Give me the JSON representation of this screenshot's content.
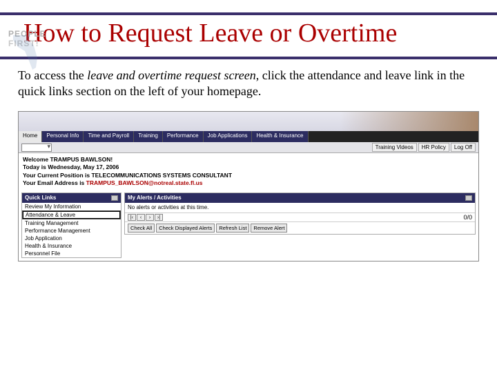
{
  "logo": {
    "line1": "PEOPLE",
    "line2": "FIRST!"
  },
  "title": "How to Request Leave or Overtime",
  "body": {
    "pre": "To access the ",
    "ital": "leave and overtime request screen",
    "post": ", click the attendance and leave link in the quick links section on the left of your homepage."
  },
  "screenshot": {
    "tabs": [
      "Home",
      "Personal Info",
      "Time and Payroll",
      "Training",
      "Performance",
      "Job Applications",
      "Health & Insurance"
    ],
    "sublinks": [
      "Training Videos",
      "HR Policy",
      "Log Off"
    ],
    "welcome": {
      "l1": "Welcome TRAMPUS BAWLSON!",
      "l2": "Today is Wednesday, May 17, 2006",
      "l3": "Your Current Position is TELECOMMUNICATIONS SYSTEMS CONSULTANT",
      "l4_pre": "Your Email Address is ",
      "l4_email": "TRAMPUS_BAWLSON@notreal.state.fl.us"
    },
    "quicklinks": {
      "header": "Quick Links",
      "items": [
        "Review My Information",
        "Attendance & Leave",
        "Training Management",
        "Performance Management",
        "Job Application",
        "Health & Insurance",
        "Personnel File"
      ]
    },
    "alerts": {
      "header": "My Alerts / Activities",
      "body": "No alerts or activities at this time.",
      "pager": "0/0",
      "buttons": [
        "Check All",
        "Check Displayed Alerts",
        "Refresh List",
        "Remove Alert"
      ]
    }
  }
}
